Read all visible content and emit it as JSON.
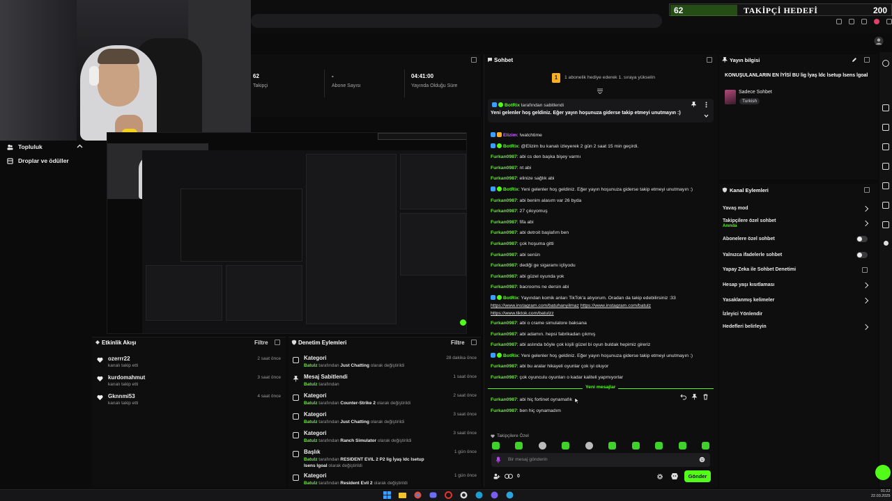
{
  "follower_goal": {
    "count": "62",
    "title": "TAKİPÇİ HEDEFİ",
    "target": "200"
  },
  "sidebar": {
    "items": [
      {
        "label": "Topluluk",
        "icon": "community-icon"
      },
      {
        "label": "Droplar ve ödüller",
        "icon": "drops-icon"
      }
    ]
  },
  "stats": [
    {
      "value": "62",
      "label": "Takipçi"
    },
    {
      "value": "-",
      "label": "Abone Sayısı"
    },
    {
      "value": "04:41:00",
      "label": "Yayında Olduğu Süre"
    }
  ],
  "activity": {
    "title": "Etkinlik Akışı",
    "filter": "Filtre",
    "events": [
      {
        "name": "ozerrr22",
        "sub": "kanalı takip etti",
        "time": "2 saat önce"
      },
      {
        "name": "kurdomahmut",
        "sub": "kanalı takip etti",
        "time": "3 saat önce"
      },
      {
        "name": "Gknnmi53",
        "sub": "kanalı takip etti",
        "time": "4 saat önce"
      }
    ]
  },
  "moderation": {
    "title": "Denetim Eylemleri",
    "filter": "Filtre",
    "actions": [
      {
        "title": "Kategori",
        "who": "Batulz",
        "pre": " tarafından ",
        "hl": "Just Chatting",
        "post": " olarak değiştirildi",
        "time": "28 dakika önce",
        "icon": "category-icon"
      },
      {
        "title": "Mesaj Sabitlendi",
        "who": "Batulz",
        "pre": " tarafından",
        "hl": "",
        "post": "",
        "time": "1 saat önce",
        "icon": "pin-icon"
      },
      {
        "title": "Kategori",
        "who": "Batulz",
        "pre": " tarafından ",
        "hl": "Counter-Strike 2",
        "post": " olarak değiştirildi",
        "time": "2 saat önce",
        "icon": "category-icon"
      },
      {
        "title": "Kategori",
        "who": "Batulz",
        "pre": " tarafından ",
        "hl": "Just Chatting",
        "post": " olarak değiştirildi",
        "time": "3 saat önce",
        "icon": "category-icon"
      },
      {
        "title": "Kategori",
        "who": "Batulz",
        "pre": " tarafından ",
        "hl": "Ranch Simulator",
        "post": " olarak değiştirildi",
        "time": "3 saat önce",
        "icon": "category-icon"
      },
      {
        "title": "Başlık",
        "who": "Batulz",
        "pre": " tarafından ",
        "hl": "RESIDENT EVIL 2 P2 lig İyaş ldc lsetup lsens lgoal",
        "post": " olarak değiştirildi",
        "time": "1 gün önce",
        "icon": "title-icon"
      },
      {
        "title": "Kategori",
        "who": "Batulz",
        "pre": " tarafından ",
        "hl": "Resident Evil 2",
        "post": " olarak değiştirildi",
        "time": "1 gün önce",
        "icon": "category-icon"
      }
    ]
  },
  "chat": {
    "title": "Sohbet",
    "gift_rank": "1",
    "gift_banner": "1 abonelik hediye ederek 1. sıraya yükselin",
    "pinned_by_user": "BotRix",
    "pinned_by_suffix": " tarafından sabitlendi",
    "pinned_text": "Yeni gelenler hoş geldiniz. Eğer yayın hoşunuza giderse takip etmeyi unutmayın :)",
    "messages": [
      {
        "user": "Elizim",
        "type": "eli",
        "text": ": !watchtime"
      },
      {
        "user": "BotRix",
        "type": "bot",
        "text": ": @Elizim bu kanalı izleyerek 2 gün 2 saat 15 min geçirdi."
      },
      {
        "user": "Furkan0987",
        "type": "u",
        "text": ": abi cs den başka bişey varmı"
      },
      {
        "user": "Furkan0987",
        "type": "u",
        "text": ": nt abi"
      },
      {
        "user": "Furkan0987",
        "type": "u",
        "text": ": elinize sağlık abi"
      },
      {
        "user": "BotRix",
        "type": "bot",
        "text": ": Yeni gelenler hoş geldiniz. Eğer yayın hoşunuza giderse takip etmeyi unutmayın :)"
      },
      {
        "user": "Furkan0987",
        "type": "u",
        "text": ": abi benim alasım var 26 byda"
      },
      {
        "user": "Furkan0987",
        "type": "u",
        "text": ": 27 çıkıyomuş"
      },
      {
        "user": "Furkan0987",
        "type": "u",
        "text": ": fifa abi"
      },
      {
        "user": "Furkan0987",
        "type": "u",
        "text": ": abi detroit başlafım ben"
      },
      {
        "user": "Furkan0987",
        "type": "u",
        "text": ": çok hoşuma gitti"
      },
      {
        "user": "Furkan0987",
        "type": "u",
        "text": ": abi senün"
      },
      {
        "user": "Furkan0987",
        "type": "u",
        "text": ": dediği ge sigaramı içliyodu"
      },
      {
        "user": "Furkan0987",
        "type": "u",
        "text": ": abi güzel oyunda yok"
      },
      {
        "user": "Furkan0987",
        "type": "u",
        "text": ": bacrooms ne dersin abi"
      }
    ],
    "tiktok_user": "BotRix",
    "tiktok_text": ": Yayından komik anları TikTok'a atıyorum. Oradan da takip edebilirsiniz :33",
    "tiktok_link1": "https://www.instagram.com/batuhanyilmaz",
    "tiktok_link2": "https://www.instagram.com/batulz",
    "tiktok_link3": "https://www.tiktok.com/batulzz",
    "messages2": [
      {
        "user": "Furkan0987",
        "type": "u",
        "text": ": abi o crame simulatore baksana"
      },
      {
        "user": "Furkan0987",
        "type": "u",
        "text": ": abi adamın. hepsi fabrikadan çıkmış"
      },
      {
        "user": "Furkan0987",
        "type": "u",
        "text": ": abi aslında böyle çok kişili güzel bi oyun buldak hepimiz gireriz"
      },
      {
        "user": "BotRix",
        "type": "bot",
        "text": ": Yeni gelenler hoş geldiniz. Eğer yayın hoşunuza giderse takip etmeyi unutmayın :)"
      },
      {
        "user": "Furkan0987",
        "type": "u",
        "text": ": abi bu aralar hikayeli oyunlar çok iyi oluyor"
      },
      {
        "user": "Furkan0987",
        "type": "u",
        "text": ": çok oyunculu oyunları o kadar kaliteli yapmıyorlar"
      }
    ],
    "new_messages_label": "Yeni mesajlar",
    "messages3": [
      {
        "user": "Furkan0987",
        "type": "u",
        "text": ": abi hiç fortinet oynamafık"
      },
      {
        "user": "Furkan0987",
        "type": "u",
        "text": ": ben hiç oynamadım"
      }
    ],
    "followers_only_label": "Takipçilere Özel",
    "input_placeholder": "Bir mesaj gönderin",
    "counter": "0",
    "send_label": "Gönder"
  },
  "stream_info": {
    "title": "Yayın bilgisi",
    "stream_title": "KONUŞULANLARIN EN İYİSİ BU lig İyaş ldc lsetup lsens lgoal",
    "category": "Sadece Sohbet",
    "language": "Turkish"
  },
  "channel_actions": {
    "title": "Kanal Eylemleri",
    "items": [
      {
        "label": "Yavaş mod",
        "control": "chevron"
      },
      {
        "label": "Takipçilere özel sohbet",
        "sub": "Anında",
        "control": "chevron"
      },
      {
        "label": "Abonelere özel sohbet",
        "control": "toggle"
      },
      {
        "label": "Yalnızca ifadelerle sohbet",
        "control": "toggle"
      },
      {
        "label": "Yapay Zeka ile Sohbet Denetimi",
        "control": "popout"
      },
      {
        "label": "Hesap yaşı kısıtlaması",
        "control": "chevron"
      },
      {
        "label": "Yasaklanmış kelimeler",
        "control": "chevron"
      },
      {
        "label": "İzleyici Yönlendir",
        "control": ""
      },
      {
        "label": "Hedefleri belirleyin",
        "control": "chevron"
      }
    ]
  },
  "taskbar": {
    "time": "01:22",
    "date": "22.03.2025"
  },
  "colors": {
    "accent": "#53fc18",
    "bg": "#0b0b0c",
    "panel": "#121213"
  }
}
